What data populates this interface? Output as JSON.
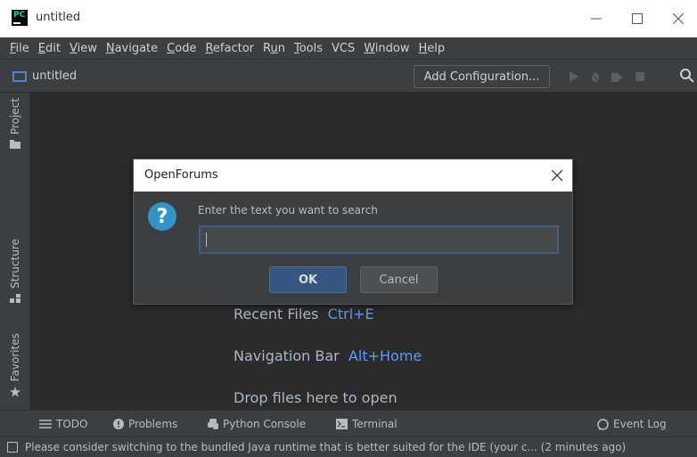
{
  "window": {
    "app_icon_text": "PC",
    "title": "untitled",
    "minimize_glyph": "—",
    "maximize_glyph": "☐",
    "close_glyph": "✕"
  },
  "menu": {
    "items": [
      {
        "mnemonic": "F",
        "rest": "ile"
      },
      {
        "mnemonic": "E",
        "rest": "dit"
      },
      {
        "mnemonic": "V",
        "rest": "iew"
      },
      {
        "mnemonic": "N",
        "rest": "avigate"
      },
      {
        "mnemonic": "C",
        "rest": "ode"
      },
      {
        "mnemonic": "R",
        "rest": "efactor"
      },
      {
        "pre": "R",
        "mnemonic": "u",
        "rest": "n"
      },
      {
        "mnemonic": "T",
        "rest": "ools"
      },
      {
        "pre": "VCS",
        "mnemonic": "",
        "rest": ""
      },
      {
        "mnemonic": "W",
        "rest": "indow"
      },
      {
        "mnemonic": "H",
        "rest": "elp"
      }
    ]
  },
  "navbar": {
    "project": "untitled",
    "add_configuration": "Add Configuration..."
  },
  "left_tabs": {
    "project": "Project",
    "structure": "Structure",
    "favorites": "Favorites"
  },
  "editor_hints": {
    "recent_files": "Recent Files",
    "recent_files_key": "Ctrl+E",
    "navigation_bar": "Navigation Bar",
    "navigation_bar_key": "Alt+Home",
    "drop_files": "Drop files here to open"
  },
  "bottom_tabs": {
    "todo": "TODO",
    "problems": "Problems",
    "python_console": "Python Console",
    "terminal": "Terminal",
    "event_log": "Event Log"
  },
  "status": {
    "message": "Please consider switching to the bundled Java runtime that is better suited for the IDE (your c... (2 minutes ago)"
  },
  "dialog": {
    "title": "OpenForums",
    "close_glyph": "✕",
    "icon_glyph": "?",
    "prompt": "Enter the text you want to search",
    "input_value": "",
    "ok_label": "OK",
    "cancel_label": "Cancel"
  },
  "colors": {
    "accent": "#3592c4",
    "link_key": "#589df6",
    "ok_button": "#365880"
  }
}
